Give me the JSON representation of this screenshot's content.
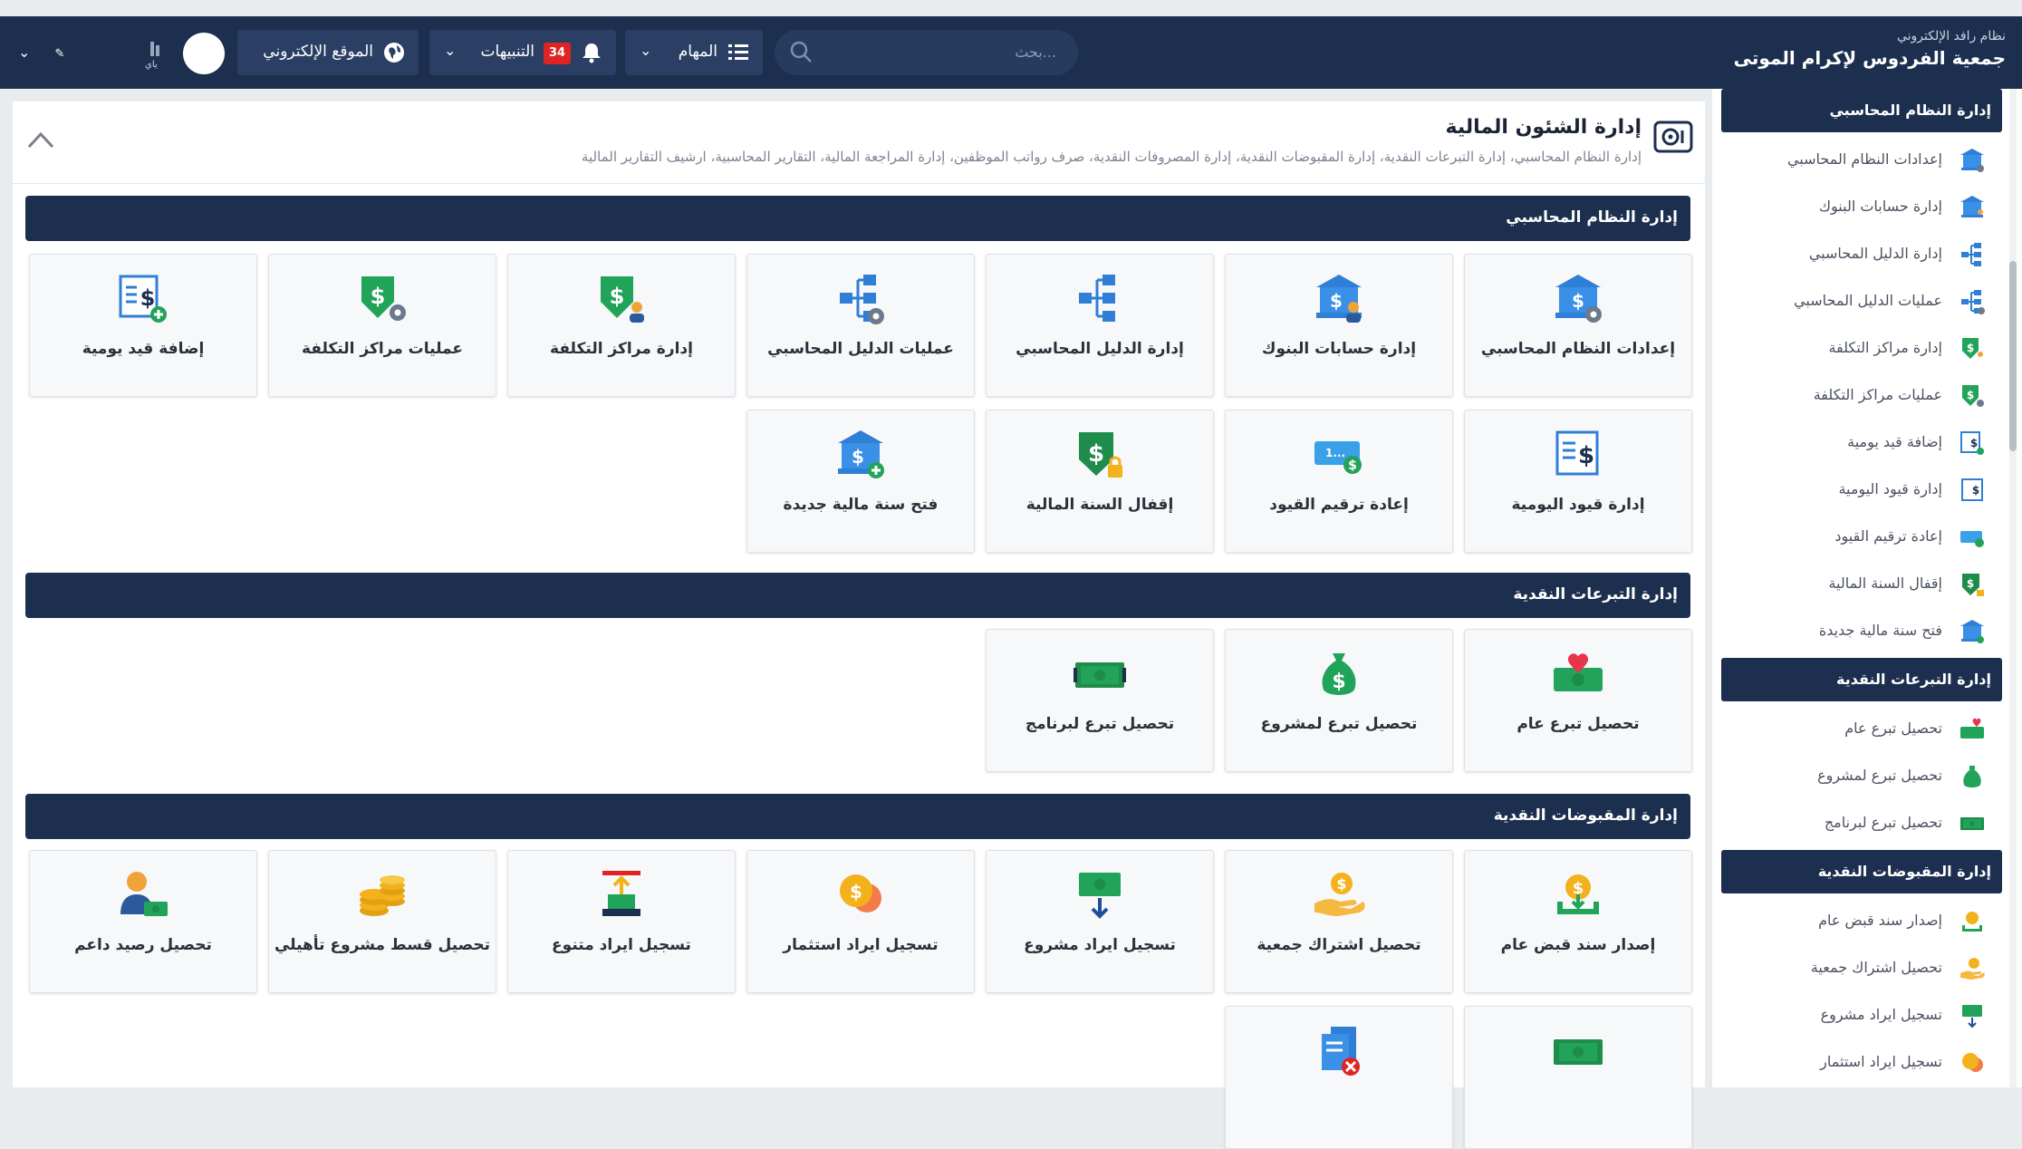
{
  "topbar": {
    "brand_sub": "نظام رافد الإلكتروني",
    "brand_title": "جمعية الفردوس لإكرام الموتى",
    "search_placeholder": "بحث...",
    "tasks_label": "المهام",
    "notifications_label": "التنبيهات",
    "notifications_count": "34",
    "website_label": "الموقع الإلكتروني",
    "user_short": "ياي"
  },
  "page": {
    "title": "إدارة الشئون المالية",
    "subtitle": "إدارة النظام المحاسبي، إدارة التبرعات النقدية، إدارة المقبوضات النقدية، إدارة المصروفات النقدية، صرف رواتب الموظفين، إدارة المراجعة المالية، التقارير المحاسبية، ارشيف التقارير المالية"
  },
  "sections": [
    {
      "title": "إدارة النظام المحاسبي",
      "tiles": [
        {
          "label": "إعدادات النظام المحاسبي",
          "icon": "bank-gear-icon"
        },
        {
          "label": "إدارة حسابات البنوك",
          "icon": "bank-user-icon"
        },
        {
          "label": "إدارة الدليل المحاسبي",
          "icon": "tree-icon"
        },
        {
          "label": "عمليات الدليل المحاسبي",
          "icon": "tree-gear-icon"
        },
        {
          "label": "إدارة مراكز التكلفة",
          "icon": "shield-dollar-user-icon"
        },
        {
          "label": "عمليات مراكز التكلفة",
          "icon": "shield-dollar-gear-icon"
        },
        {
          "label": "إضافة قيد يومية",
          "icon": "journal-add-icon"
        },
        {
          "label": "إدارة قيود اليومية",
          "icon": "journal-icon"
        },
        {
          "label": "إعادة ترقيم القيود",
          "icon": "renumber-icon"
        },
        {
          "label": "إقفال السنة المالية",
          "icon": "lock-year-icon"
        },
        {
          "label": "فتح سنة مالية جديدة",
          "icon": "bank-plus-icon"
        }
      ]
    },
    {
      "title": "إدارة التبرعات النقدية",
      "tiles": [
        {
          "label": "تحصيل تبرع عام",
          "icon": "heart-cash-icon"
        },
        {
          "label": "تحصيل تبرع لمشروع",
          "icon": "money-bag-icon"
        },
        {
          "label": "تحصيل تبرع لبرنامج",
          "icon": "banknote-icon"
        }
      ]
    },
    {
      "title": "إدارة المقبوضات النقدية",
      "tiles": [
        {
          "label": "إصدار سند قبض عام",
          "icon": "receipt-hand-icon"
        },
        {
          "label": "تحصيل اشتراك جمعية",
          "icon": "hand-coin-icon"
        },
        {
          "label": "تسجيل ايراد مشروع",
          "icon": "cash-down-icon"
        },
        {
          "label": "تسجيل ايراد استثمار",
          "icon": "coins-icon"
        },
        {
          "label": "تسجيل ايراد متنوع",
          "icon": "upload-tray-icon"
        },
        {
          "label": "تحصيل قسط مشروع تأهيلي",
          "icon": "coin-stack-icon"
        },
        {
          "label": "تحصيل رصيد داعم",
          "icon": "user-cash-icon"
        },
        {
          "label": "",
          "icon": "banknote-icon"
        },
        {
          "label": "",
          "icon": "document-cancel-icon"
        }
      ]
    }
  ],
  "sidebar": {
    "groups": [
      {
        "title": "إدارة النظام المحاسبي",
        "items": [
          {
            "label": "إعدادات النظام المحاسبي",
            "icon": "bank-gear-icon"
          },
          {
            "label": "إدارة حسابات البنوك",
            "icon": "bank-user-icon"
          },
          {
            "label": "إدارة الدليل المحاسبي",
            "icon": "tree-icon"
          },
          {
            "label": "عمليات الدليل المحاسبي",
            "icon": "tree-gear-icon"
          },
          {
            "label": "إدارة مراكز التكلفة",
            "icon": "shield-dollar-user-icon"
          },
          {
            "label": "عمليات مراكز التكلفة",
            "icon": "shield-dollar-gear-icon"
          },
          {
            "label": "إضافة قيد يومية",
            "icon": "journal-add-icon"
          },
          {
            "label": "إدارة قيود اليومية",
            "icon": "journal-icon"
          },
          {
            "label": "إعادة ترقيم القيود",
            "icon": "renumber-icon"
          },
          {
            "label": "إقفال السنة المالية",
            "icon": "lock-year-icon"
          },
          {
            "label": "فتح سنة مالية جديدة",
            "icon": "bank-plus-icon"
          }
        ]
      },
      {
        "title": "إدارة التبرعات النقدية",
        "items": [
          {
            "label": "تحصيل تبرع عام",
            "icon": "heart-cash-icon"
          },
          {
            "label": "تحصيل تبرع لمشروع",
            "icon": "money-bag-icon"
          },
          {
            "label": "تحصيل تبرع لبرنامج",
            "icon": "banknote-icon"
          }
        ]
      },
      {
        "title": "إدارة المقبوضات النقدية",
        "items": [
          {
            "label": "إصدار سند قبض عام",
            "icon": "receipt-hand-icon"
          },
          {
            "label": "تحصيل اشتراك جمعية",
            "icon": "hand-coin-icon"
          },
          {
            "label": "تسجيل ايراد مشروع",
            "icon": "cash-down-icon"
          },
          {
            "label": "تسجيل ايراد استثمار",
            "icon": "coins-icon"
          }
        ]
      }
    ]
  },
  "colors": {
    "navy": "#1d2f4f",
    "blue": "#2f7fd6",
    "green": "#22a35a",
    "dark_green": "#1e8c4a",
    "gold": "#f3b21b",
    "red": "#e02424"
  }
}
